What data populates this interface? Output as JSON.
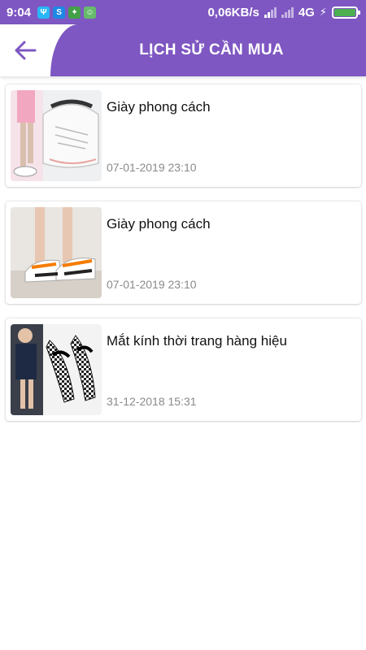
{
  "status_bar": {
    "time": "9:04",
    "notifications": [
      {
        "icon": "usb-debug-icon",
        "color": "#29b6f6",
        "glyph": "Ψ"
      },
      {
        "icon": "skype-icon",
        "color": "#1e88e5",
        "glyph": "S"
      },
      {
        "icon": "puzzle-app-icon",
        "color": "#43a047",
        "glyph": "✦"
      },
      {
        "icon": "android-app-icon",
        "color": "#66bb6a",
        "glyph": "☺"
      }
    ],
    "net_speed": "0,06KB/s",
    "network_type": "4G",
    "battery_level": 1.0,
    "battery_color": "#4caf50"
  },
  "toolbar": {
    "title": "LỊCH SỬ CẦN MUA",
    "accent_color": "#7e57c2"
  },
  "history": {
    "items": [
      {
        "name": "Giày phong cách",
        "time": "07-01-2019 23:10",
        "thumbnail": "white-sneakers-photo"
      },
      {
        "name": "Giày phong cách",
        "time": "07-01-2019 23:10",
        "thumbnail": "orange-stripe-sneakers-photo"
      },
      {
        "name": "Mắt kính thời trang hàng hiệu",
        "time": "31-12-2018 15:31",
        "thumbnail": "checkered-heels-photo"
      }
    ]
  }
}
